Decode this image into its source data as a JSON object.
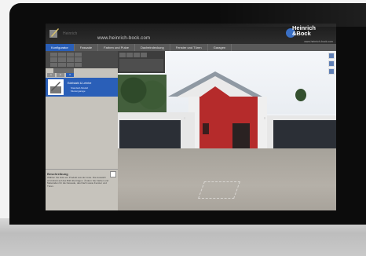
{
  "header": {
    "name": "Heinrich",
    "url": "www.heinrich-bock.com",
    "brand_line1": "Heinrich",
    "brand_line2": "&Bock",
    "brand_url": "www.heinrich-bock.com"
  },
  "navbar": {
    "items": [
      {
        "label": "Konfigurator"
      },
      {
        "label": "Fassade"
      },
      {
        "label": "Farben und Putze"
      },
      {
        "label": "Dacheindeckung"
      },
      {
        "label": "Fenster und Türen"
      },
      {
        "label": "Garagen"
      }
    ]
  },
  "left_panel": {
    "level_tabs": [
      "1",
      "2",
      "3"
    ],
    "selected_item": {
      "title": "Edelstahl & Lehrbe",
      "subtitle": "Standard-Modell\nMustergarage"
    },
    "description": {
      "title": "Beschreibung",
      "text": "Wählen Sie links ein Produkt aus der Liste. Die Auswahl wird direkt auf das Bild übertragen. Ändern Sie Farben und Materialien für die Fassade, das Dach sowie Fenster und Türen."
    }
  },
  "colors": {
    "accent": "#2a5fb8",
    "house_red": "#b52b2b",
    "panel_bg": "#c6c3bc"
  }
}
